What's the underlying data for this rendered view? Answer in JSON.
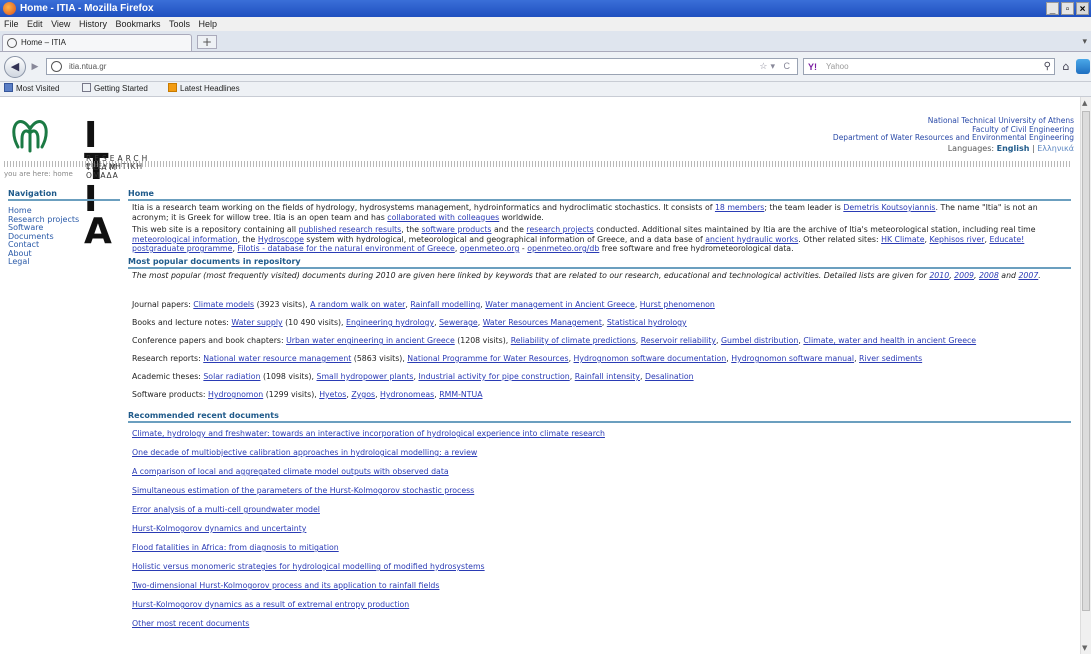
{
  "browser": {
    "window_title": "Home - ITIA - Mozilla Firefox",
    "menu": [
      "File",
      "Edit",
      "View",
      "History",
      "Bookmarks",
      "Tools",
      "Help"
    ],
    "tab_label": "Home – ITIA",
    "url": "itia.ntua.gr",
    "search_placeholder": "Yahoo",
    "search_engine": "Y!",
    "bookmarks": [
      "Most Visited",
      "Getting Started",
      "Latest Headlines"
    ]
  },
  "header": {
    "logo_text": "I T I A",
    "logo_research": "RESEARCH  TEAM",
    "logo_greek": "ΕΡΕΥΝΗΤΙΚΗ   ΟΜΑΔΑ",
    "institution": [
      "National Technical University of Athens",
      "Faculty of Civil Engineering",
      "Department of Water Resources and Environmental Engineering"
    ],
    "languages_label": "Languages:",
    "lang_current": "English",
    "lang_sep": "|",
    "lang_other": "Ελληνικά",
    "breadcrumb": "you are here: home"
  },
  "nav": {
    "heading": "Navigation",
    "items": [
      "Home",
      "Research projects",
      "Software",
      "Documents",
      "Contact",
      "About",
      "Legal"
    ]
  },
  "main": {
    "heading": "Home",
    "intro1": [
      {
        "t": "Itia is a research team working on the fields of hydrology, hydrosystems management, hydroinformatics and hydroclimatic stochastics. It consists of "
      },
      {
        "t": "18 members",
        "link": true
      },
      {
        "t": "; the team leader is "
      },
      {
        "t": "Demetris Koutsoyiannis",
        "link": true
      },
      {
        "t": ". The name \"Itia\" is not an acronym; it is Greek for willow tree. Itia is an open team and has "
      },
      {
        "t": "collaborated with colleagues",
        "link": true
      },
      {
        "t": " worldwide."
      }
    ],
    "intro2": [
      {
        "t": "This web site is a repository containing all "
      },
      {
        "t": "published research results",
        "link": true
      },
      {
        "t": ", the "
      },
      {
        "t": "software products",
        "link": true
      },
      {
        "t": " and the "
      },
      {
        "t": "research projects",
        "link": true
      },
      {
        "t": " conducted. Additional sites maintained by Itia are the archive of Itia's meteorological station, including real time "
      },
      {
        "t": "meteorological information",
        "link": true
      },
      {
        "t": ", the "
      },
      {
        "t": "Hydroscope",
        "link": true
      },
      {
        "t": " system with hydrological, meteorological and geographical information of Greece, and a data base of "
      },
      {
        "t": "ancient hydraulic works",
        "link": true
      },
      {
        "t": ". Other related sites: "
      },
      {
        "t": "HK Climate",
        "link": true
      },
      {
        "t": ", "
      },
      {
        "t": "Kephisos river",
        "link": true
      },
      {
        "t": ", "
      },
      {
        "t": "Educate! postgraduate programme",
        "link": true
      },
      {
        "t": ", "
      },
      {
        "t": "Filotis - database for the natural environment of Greece",
        "link": true
      },
      {
        "t": ", "
      },
      {
        "t": "openmeteo.org",
        "link": true
      },
      {
        "t": " - "
      },
      {
        "t": "openmeteo.org/db",
        "link": true
      },
      {
        "t": " free software and free hydrometeorological data."
      }
    ],
    "popular": {
      "heading": "Most popular documents in repository",
      "intro": [
        {
          "t": "The most popular (most frequently visited) documents during 2010 are given here linked by keywords that are related to our research, educational and technological activities. Detailed lists are given for "
        },
        {
          "t": "2010",
          "link": true
        },
        {
          "t": ", "
        },
        {
          "t": "2009",
          "link": true
        },
        {
          "t": ", "
        },
        {
          "t": "2008",
          "link": true
        },
        {
          "t": " and "
        },
        {
          "t": "2007",
          "link": true
        },
        {
          "t": "."
        }
      ],
      "rows": [
        [
          {
            "t": "Journal papers: "
          },
          {
            "t": "Climate models",
            "link": true
          },
          {
            "t": " (3923 visits), "
          },
          {
            "t": "A random walk on water",
            "link": true
          },
          {
            "t": ", "
          },
          {
            "t": "Rainfall modelling",
            "link": true
          },
          {
            "t": ", "
          },
          {
            "t": "Water management in Ancient Greece",
            "link": true
          },
          {
            "t": ", "
          },
          {
            "t": "Hurst phenomenon",
            "link": true
          }
        ],
        [
          {
            "t": "Books and lecture notes: "
          },
          {
            "t": "Water supply",
            "link": true
          },
          {
            "t": " (10 490 visits), "
          },
          {
            "t": "Engineering hydrology",
            "link": true
          },
          {
            "t": ", "
          },
          {
            "t": "Sewerage",
            "link": true
          },
          {
            "t": ", "
          },
          {
            "t": "Water Resources Management",
            "link": true
          },
          {
            "t": ", "
          },
          {
            "t": "Statistical hydrology",
            "link": true
          }
        ],
        [
          {
            "t": "Conference papers and book chapters: "
          },
          {
            "t": "Urban water engineering in ancient Greece",
            "link": true
          },
          {
            "t": " (1208 visits), "
          },
          {
            "t": "Reliability of climate predictions",
            "link": true
          },
          {
            "t": ", "
          },
          {
            "t": "Reservoir reliability",
            "link": true
          },
          {
            "t": ", "
          },
          {
            "t": "Gumbel distribution",
            "link": true
          },
          {
            "t": ", "
          },
          {
            "t": "Climate, water and health in ancient Greece",
            "link": true
          }
        ],
        [
          {
            "t": "Research reports: "
          },
          {
            "t": "National water resource management",
            "link": true
          },
          {
            "t": " (5863 visits), "
          },
          {
            "t": "National Programme for Water Resources",
            "link": true
          },
          {
            "t": ", "
          },
          {
            "t": "Hydrognomon software documentation",
            "link": true
          },
          {
            "t": ", "
          },
          {
            "t": "Hydrognomon software manual",
            "link": true
          },
          {
            "t": ", "
          },
          {
            "t": "River sediments",
            "link": true
          }
        ],
        [
          {
            "t": "Academic theses: "
          },
          {
            "t": "Solar radiation",
            "link": true
          },
          {
            "t": " (1098 visits), "
          },
          {
            "t": "Small hydropower plants",
            "link": true
          },
          {
            "t": ", "
          },
          {
            "t": "Industrial activity for pipe construction",
            "link": true
          },
          {
            "t": ", "
          },
          {
            "t": "Rainfall intensity",
            "link": true
          },
          {
            "t": ", "
          },
          {
            "t": "Desalination",
            "link": true
          }
        ],
        [
          {
            "t": "Software products: "
          },
          {
            "t": "Hydrognomon",
            "link": true
          },
          {
            "t": " (1299 visits), "
          },
          {
            "t": "Hyetos",
            "link": true
          },
          {
            "t": ", "
          },
          {
            "t": "Zygos",
            "link": true
          },
          {
            "t": ", "
          },
          {
            "t": "Hydronomeas",
            "link": true
          },
          {
            "t": ", "
          },
          {
            "t": "RMM-NTUA",
            "link": true
          }
        ]
      ]
    },
    "recent": {
      "heading": "Recommended recent documents",
      "items": [
        "Climate, hydrology and freshwater: towards an interactive incorporation of hydrological experience into climate research",
        "One decade of multiobjective calibration approaches in hydrological modelling: a review",
        "A comparison of local and aggregated climate model outputs with observed data",
        "Simultaneous estimation of the parameters of the Hurst-Kolmogorov stochastic process",
        "Error analysis of a multi-cell groundwater model",
        "Hurst-Kolmogorov dynamics and uncertainty",
        "Flood fatalities in Africa: from diagnosis to mitigation",
        "Holistic versus monomeric strategies for hydrological modelling of modified hydrosystems",
        "Two-dimensional Hurst-Kolmogorov process and its application to rainfall fields",
        "Hurst-Kolmogorov dynamics as a result of extremal entropy production",
        "Other most recent documents"
      ]
    }
  }
}
